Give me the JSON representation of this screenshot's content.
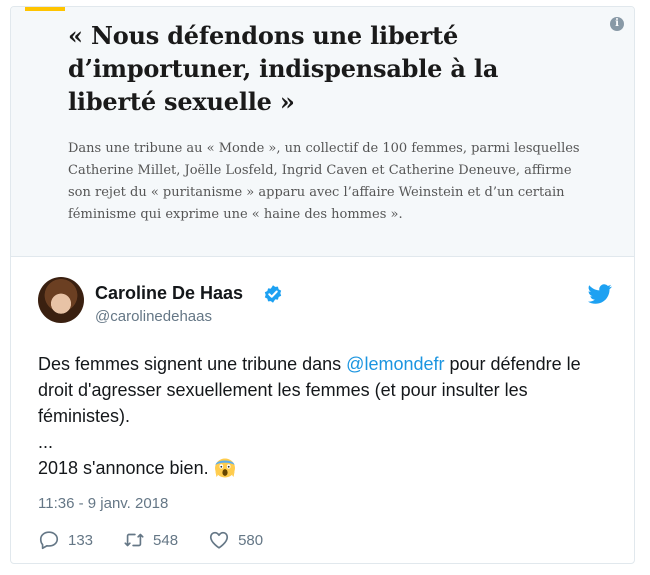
{
  "article": {
    "headline": "« Nous défendons une liberté d’importuner, indispensable à la liberté sexuelle »",
    "summary": "Dans une tribune au « Monde », un collectif de 100 femmes, parmi lesquelles Catherine Millet, Joëlle Losfeld, Ingrid Caven et Catherine Deneuve, affirme son rejet du « puritanisme » apparu avec l’affaire Weinstein et d’un certain féminisme qui exprime une « haine des hommes ».",
    "accent_color": "#ffc400",
    "info_icon": "info-icon"
  },
  "tweet": {
    "author_name": "Caroline De Haas",
    "handle": "@carolinedehaas",
    "verified": true,
    "text_before_mention": "Des femmes signent une tribune dans ",
    "mention": "@lemondefr",
    "text_after_mention": " pour défendre le droit d'agresser sexuellement les femmes (et pour insulter les féministes).",
    "ellipsis": "...",
    "closing": "2018 s'annonce bien.",
    "emoji": "face-screaming-in-fear",
    "timestamp": "11:36 - 9 janv. 2018",
    "replies": "133",
    "retweets": "548",
    "likes": "580"
  },
  "colors": {
    "twitter_blue": "#1da1f2",
    "mention": "#1b95e0",
    "muted": "#657786"
  }
}
